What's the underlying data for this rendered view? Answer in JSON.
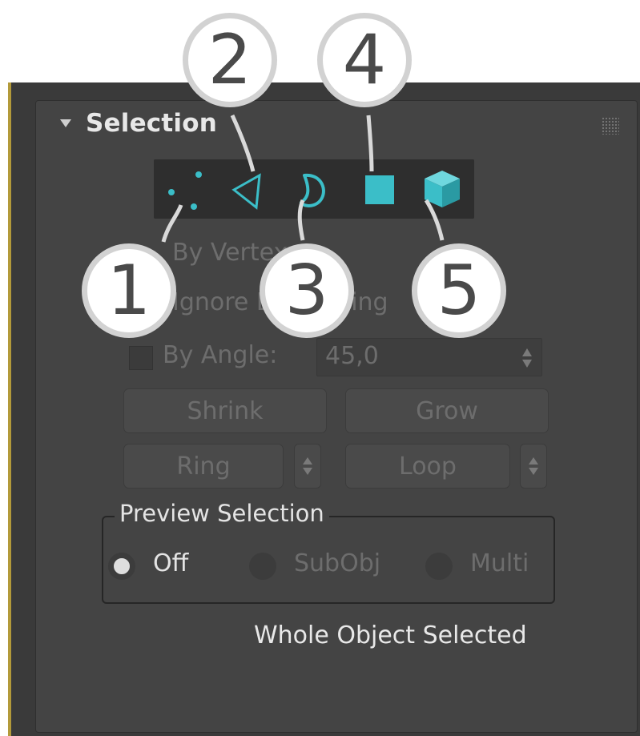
{
  "rollout": {
    "title": "Selection"
  },
  "subobject_levels": [
    {
      "level": "vertex",
      "icon": "vertex-icon",
      "callout": "1"
    },
    {
      "level": "edge",
      "icon": "edge-icon",
      "callout": "2"
    },
    {
      "level": "border",
      "icon": "border-icon",
      "callout": "3"
    },
    {
      "level": "polygon",
      "icon": "polygon-icon",
      "callout": "4"
    },
    {
      "level": "element",
      "icon": "element-icon",
      "callout": "5"
    }
  ],
  "options": {
    "by_vertex_label": "By Vertex",
    "ignore_backfacing_label": "Ignore Backfacing",
    "by_angle_label": "By Angle:",
    "by_angle_value": "45,0"
  },
  "buttons": {
    "shrink": "Shrink",
    "grow": "Grow",
    "ring": "Ring",
    "loop": "Loop"
  },
  "preview_selection": {
    "label": "Preview Selection",
    "options": [
      "Off",
      "SubObj",
      "Multi"
    ],
    "selected": "Off"
  },
  "status": "Whole Object Selected",
  "colors": {
    "accent": "#3bbec8",
    "panel": "#444444",
    "panel_border": "#b39a3a"
  }
}
